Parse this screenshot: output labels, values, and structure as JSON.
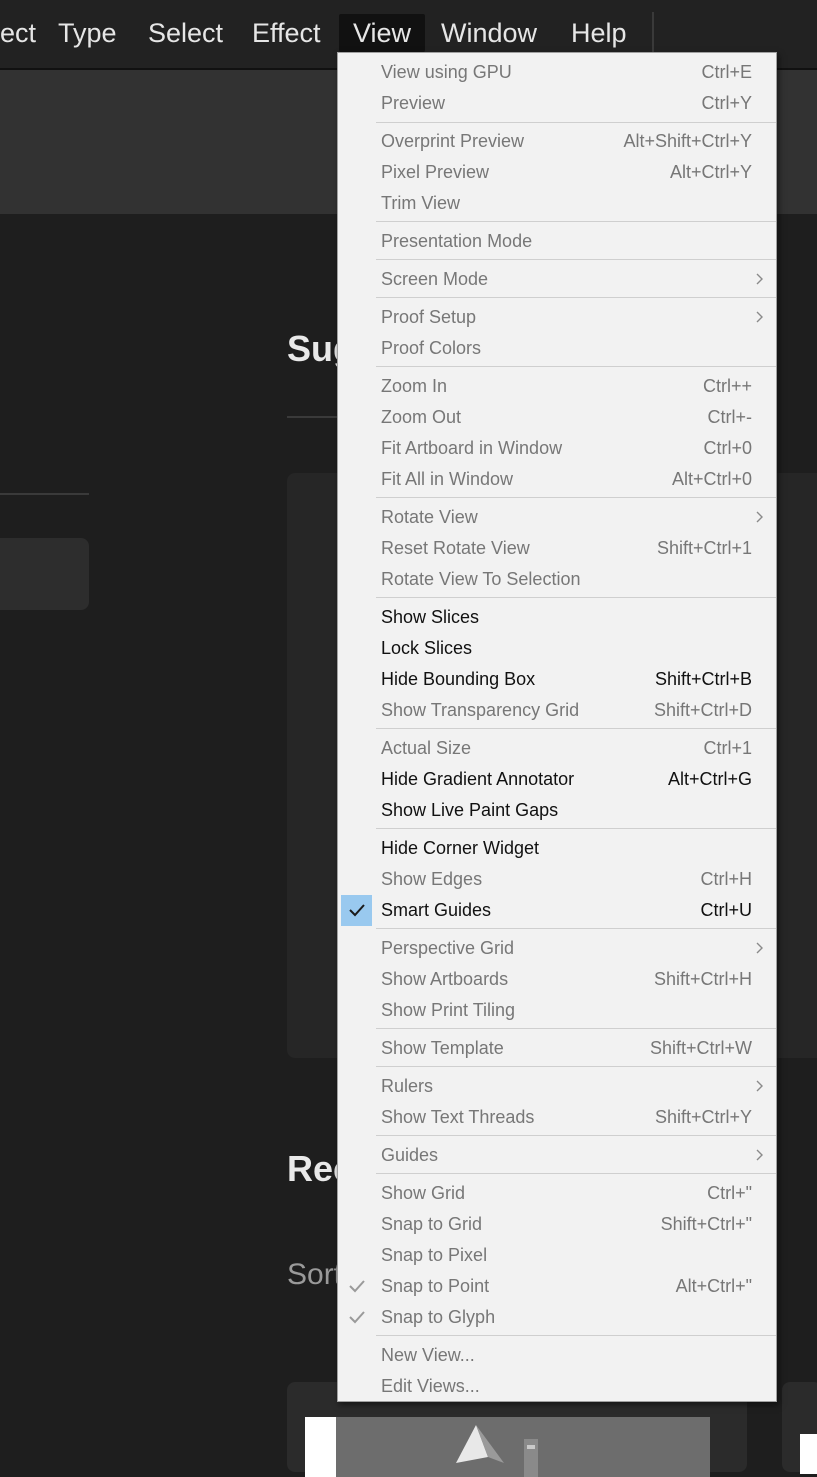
{
  "menubar": {
    "items": [
      {
        "label": "ect"
      },
      {
        "label": "Type"
      },
      {
        "label": "Select"
      },
      {
        "label": "Effect"
      },
      {
        "label": "View"
      },
      {
        "label": "Window"
      },
      {
        "label": "Help"
      }
    ],
    "active": "View"
  },
  "background": {
    "heading_suggested": "Sug",
    "heading_recent": "Rec",
    "sort_label": "Sort"
  },
  "view_menu": {
    "items": [
      {
        "label": "View using GPU",
        "shortcut": "Ctrl+E",
        "enabled": false
      },
      {
        "label": "Preview",
        "shortcut": "Ctrl+Y",
        "enabled": false
      },
      {
        "label": "Overprint Preview",
        "shortcut": "Alt+Shift+Ctrl+Y",
        "enabled": false
      },
      {
        "label": "Pixel Preview",
        "shortcut": "Alt+Ctrl+Y",
        "enabled": false
      },
      {
        "label": "Trim View",
        "shortcut": "",
        "enabled": false
      },
      {
        "label": "Presentation Mode",
        "shortcut": "",
        "enabled": false
      },
      {
        "label": "Screen Mode",
        "shortcut": "",
        "enabled": false,
        "submenu": true
      },
      {
        "label": "Proof Setup",
        "shortcut": "",
        "enabled": false,
        "submenu": true
      },
      {
        "label": "Proof Colors",
        "shortcut": "",
        "enabled": false
      },
      {
        "label": "Zoom In",
        "shortcut": "Ctrl++",
        "enabled": false
      },
      {
        "label": "Zoom Out",
        "shortcut": "Ctrl+-",
        "enabled": false
      },
      {
        "label": "Fit Artboard in Window",
        "shortcut": "Ctrl+0",
        "enabled": false
      },
      {
        "label": "Fit All in Window",
        "shortcut": "Alt+Ctrl+0",
        "enabled": false
      },
      {
        "label": "Rotate View",
        "shortcut": "",
        "enabled": false,
        "submenu": true
      },
      {
        "label": "Reset Rotate View",
        "shortcut": "Shift+Ctrl+1",
        "enabled": false
      },
      {
        "label": "Rotate View To Selection",
        "shortcut": "",
        "enabled": false
      },
      {
        "label": "Show Slices",
        "shortcut": "",
        "enabled": true
      },
      {
        "label": "Lock Slices",
        "shortcut": "",
        "enabled": true
      },
      {
        "label": "Hide Bounding Box",
        "shortcut": "Shift+Ctrl+B",
        "enabled": true
      },
      {
        "label": "Show Transparency Grid",
        "shortcut": "Shift+Ctrl+D",
        "enabled": false
      },
      {
        "label": "Actual Size",
        "shortcut": "Ctrl+1",
        "enabled": false
      },
      {
        "label": "Hide Gradient Annotator",
        "shortcut": "Alt+Ctrl+G",
        "enabled": true
      },
      {
        "label": "Show Live Paint Gaps",
        "shortcut": "",
        "enabled": true
      },
      {
        "label": "Hide Corner Widget",
        "shortcut": "",
        "enabled": true
      },
      {
        "label": "Show Edges",
        "shortcut": "Ctrl+H",
        "enabled": false
      },
      {
        "label": "Smart Guides",
        "shortcut": "Ctrl+U",
        "enabled": true,
        "checked": "active"
      },
      {
        "label": "Perspective Grid",
        "shortcut": "",
        "enabled": false,
        "submenu": true
      },
      {
        "label": "Show Artboards",
        "shortcut": "Shift+Ctrl+H",
        "enabled": false
      },
      {
        "label": "Show Print Tiling",
        "shortcut": "",
        "enabled": false
      },
      {
        "label": "Show Template",
        "shortcut": "Shift+Ctrl+W",
        "enabled": false
      },
      {
        "label": "Rulers",
        "shortcut": "",
        "enabled": false,
        "submenu": true
      },
      {
        "label": "Show Text Threads",
        "shortcut": "Shift+Ctrl+Y",
        "enabled": false
      },
      {
        "label": "Guides",
        "shortcut": "",
        "enabled": false,
        "submenu": true
      },
      {
        "label": "Show Grid",
        "shortcut": "Ctrl+\"",
        "enabled": false
      },
      {
        "label": "Snap to Grid",
        "shortcut": "Shift+Ctrl+\"",
        "enabled": false
      },
      {
        "label": "Snap to Pixel",
        "shortcut": "",
        "enabled": false
      },
      {
        "label": "Snap to Point",
        "shortcut": "Alt+Ctrl+\"",
        "enabled": false,
        "checked": "disabled"
      },
      {
        "label": "Snap to Glyph",
        "shortcut": "",
        "enabled": false,
        "checked": "disabled"
      },
      {
        "label": "New View...",
        "shortcut": "",
        "enabled": false
      },
      {
        "label": "Edit Views...",
        "shortcut": "",
        "enabled": false
      }
    ]
  },
  "colors": {
    "menu_bg": "#f2f2f2",
    "check_highlight": "#99c9ef",
    "enabled_text": "#111111",
    "disabled_text": "#777777",
    "app_bg": "#1e1e1e"
  }
}
